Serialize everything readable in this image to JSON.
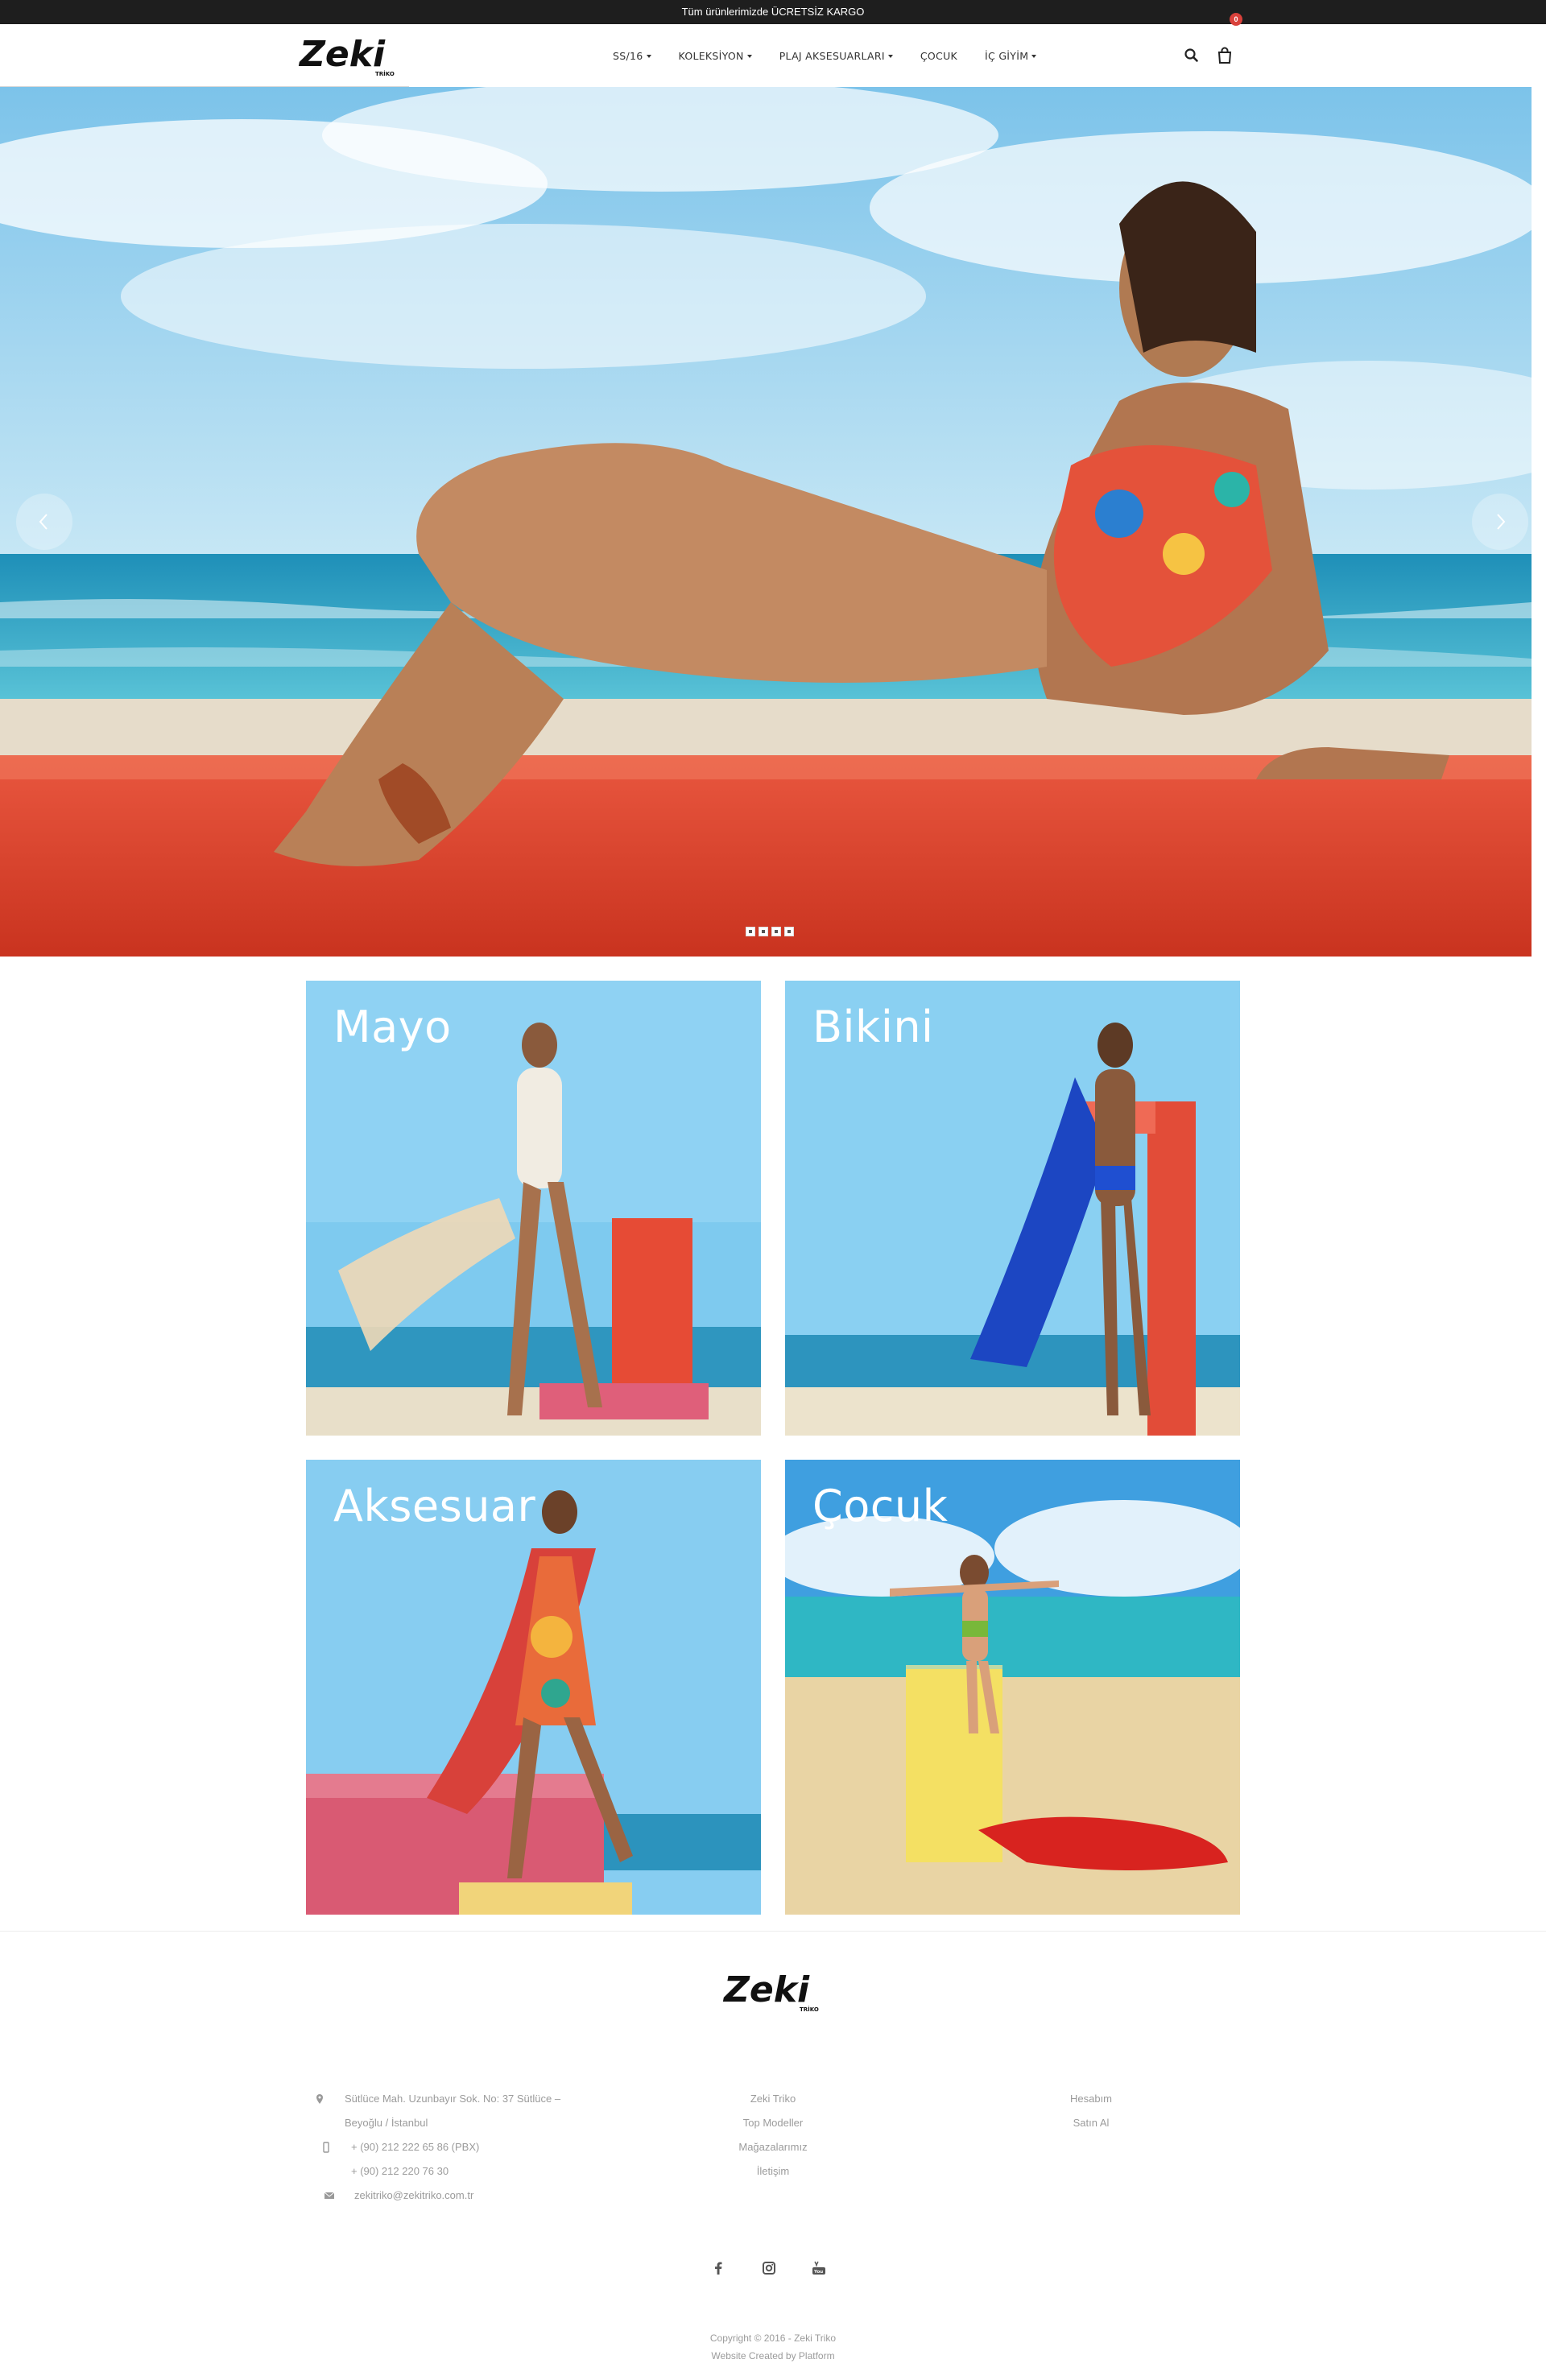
{
  "topbar": {
    "text": "Tüm ürünlerimizde ÜCRETSİZ KARGO"
  },
  "header": {
    "logo_text": "Zeki",
    "logo_sub": "TRİKO",
    "nav": [
      {
        "label": "SS/16",
        "has_dropdown": true
      },
      {
        "label": "KOLEKSİYON",
        "has_dropdown": true
      },
      {
        "label": "PLAJ AKSESUARLARI",
        "has_dropdown": true
      },
      {
        "label": "ÇOCUK",
        "has_dropdown": false
      },
      {
        "label": "İÇ GİYİM",
        "has_dropdown": true
      }
    ],
    "cart_count": "0",
    "icons": [
      "search-icon",
      "shopping-bag-icon"
    ]
  },
  "hero": {
    "slide_count": 4,
    "active_slide": 1,
    "icons": [
      "chevron-left-icon",
      "chevron-right-icon"
    ]
  },
  "categories": [
    {
      "title": "Mayo"
    },
    {
      "title": "Bikini"
    },
    {
      "title": "Aksesuar"
    },
    {
      "title": "Çocuk"
    }
  ],
  "footer": {
    "logo_text": "Zeki",
    "logo_sub": "TRİKO",
    "contact": {
      "address_line1": "Sütlüce Mah. Uzunbayır Sok. No: 37 Sütlüce –",
      "address_line2": "Beyoğlu / İstanbul",
      "phone1": "+ (90) 212 222 65 86 (PBX)",
      "phone2": "+ (90) 212 220 76 30",
      "email": "zekitriko@zekitriko.com.tr"
    },
    "links_middle": [
      "Zeki Triko",
      "Top Modeller",
      "Mağazalarımız",
      "İletişim"
    ],
    "links_right": [
      "Hesabım",
      "Satın Al"
    ],
    "social": [
      "facebook-icon",
      "instagram-icon",
      "youtube-icon"
    ],
    "copyright": "Copyright © 2016 - Zeki Triko",
    "credit": "Website Created by Platform"
  },
  "colors": {
    "topbar_bg": "#1e1e1e",
    "badge": "#d9413b",
    "sky": "#8ccfee",
    "sea": "#2aa6c9",
    "sand": "#e9dcc6",
    "red_platform": "#d9402c",
    "footer_text": "#9b9b9b"
  }
}
